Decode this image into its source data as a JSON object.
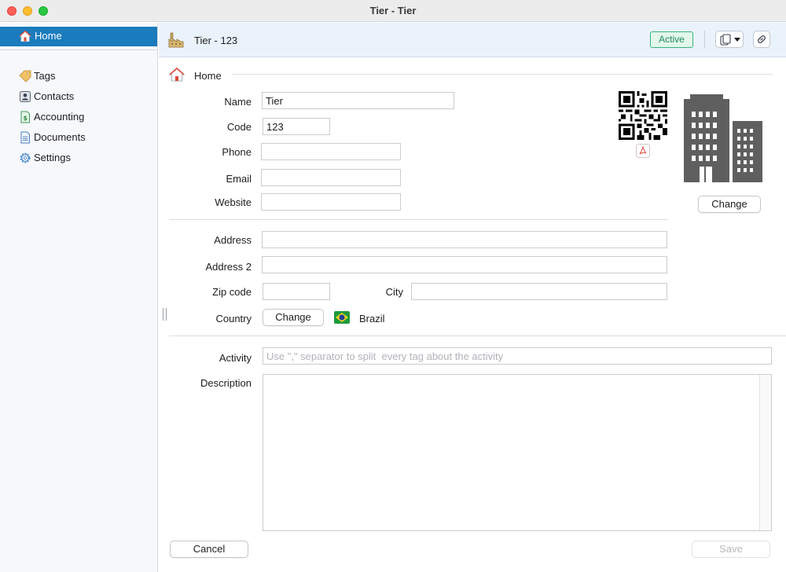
{
  "window": {
    "title": "Tier - Tier"
  },
  "sidebar": {
    "home": "Home",
    "items": [
      {
        "label": "Tags",
        "icon": "tag-icon"
      },
      {
        "label": "Contacts",
        "icon": "contact-card-icon"
      },
      {
        "label": "Accounting",
        "icon": "accounting-icon"
      },
      {
        "label": "Documents",
        "icon": "document-icon"
      },
      {
        "label": "Settings",
        "icon": "gear-icon"
      }
    ]
  },
  "header": {
    "title": "Tier - 123",
    "status": "Active",
    "status_color": "#36b37e"
  },
  "breadcrumb": {
    "label": "Home"
  },
  "form": {
    "name_label": "Name",
    "name_value": "Tier",
    "code_label": "Code",
    "code_value": "123",
    "phone_label": "Phone",
    "phone_value": "",
    "email_label": "Email",
    "email_value": "",
    "website_label": "Website",
    "website_value": "",
    "address_label": "Address",
    "address_value": "",
    "address2_label": "Address 2",
    "address2_value": "",
    "zip_label": "Zip code",
    "zip_value": "",
    "city_label": "City",
    "city_value": "",
    "country_label": "Country",
    "country_change": "Change",
    "country_value": "Brazil",
    "activity_label": "Activity",
    "activity_placeholder": "Use \",\" separator to split  every tag about the activity",
    "description_label": "Description",
    "image_change": "Change"
  },
  "footer": {
    "cancel": "Cancel",
    "save": "Save"
  },
  "colors": {
    "accent": "#1a7bbd",
    "header_bg": "#eaf2fb",
    "sidebar_bg": "#f6f8fc"
  }
}
